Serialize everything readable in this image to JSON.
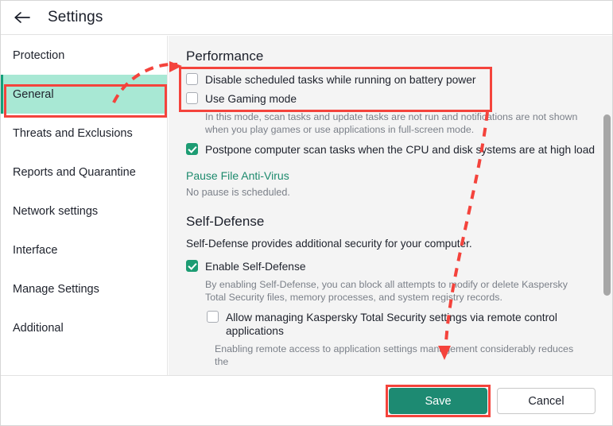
{
  "window": {
    "title": "Settings",
    "back_icon": "arrow-left-icon"
  },
  "sidebar": {
    "items": [
      {
        "label": "Protection",
        "selected": false
      },
      {
        "label": "General",
        "selected": true
      },
      {
        "label": "Threats and Exclusions",
        "selected": false
      },
      {
        "label": "Reports and Quarantine",
        "selected": false
      },
      {
        "label": "Network settings",
        "selected": false
      },
      {
        "label": "Interface",
        "selected": false
      },
      {
        "label": "Manage Settings",
        "selected": false
      },
      {
        "label": "Additional",
        "selected": false
      }
    ]
  },
  "content": {
    "performance": {
      "heading": "Performance",
      "disable_scheduled_label": "Disable scheduled tasks while running on battery power",
      "disable_scheduled_checked": false,
      "gaming_mode_label": "Use Gaming mode",
      "gaming_mode_checked": false,
      "gaming_mode_help": "In this mode, scan tasks and update tasks are not run and notifications are not shown when you play games or use applications in full-screen mode.",
      "postpone_label": "Postpone computer scan tasks when the CPU and disk systems are at high load",
      "postpone_checked": true,
      "pause_link": "Pause File Anti-Virus",
      "pause_status": "No pause is scheduled."
    },
    "self_defense": {
      "heading": "Self-Defense",
      "description": "Self-Defense provides additional security for your computer.",
      "enable_label": "Enable Self-Defense",
      "enable_checked": true,
      "enable_help": "By enabling Self-Defense, you can block all attempts to modify or delete Kaspersky Total Security files, memory processes, and system registry records.",
      "remote_label": "Allow managing Kaspersky Total Security settings via remote control applications",
      "remote_checked": false,
      "remote_help": "Enabling remote access to application settings management considerably reduces the"
    }
  },
  "footer": {
    "save_label": "Save",
    "cancel_label": "Cancel"
  },
  "annotations": {
    "highlight_color": "#f4433c",
    "accent_green": "#1d8a72",
    "selected_nav_bg": "#a8e8d4"
  }
}
